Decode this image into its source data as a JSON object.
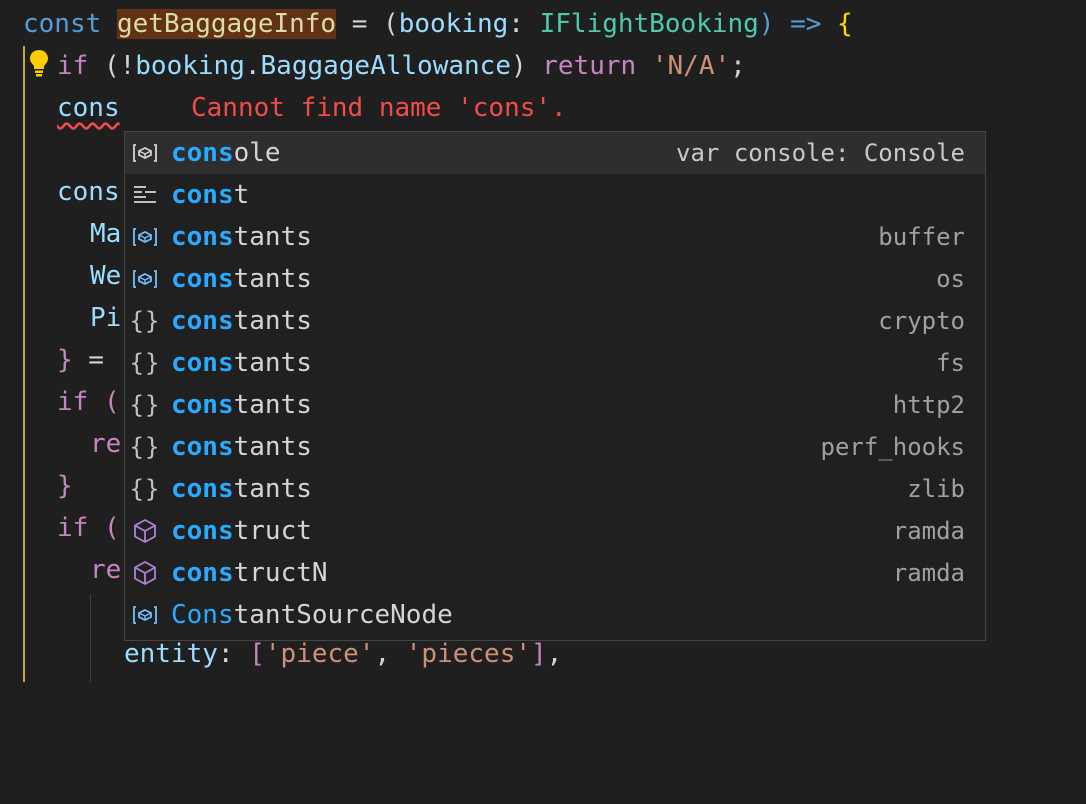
{
  "editor": {
    "line1": {
      "kw": "const",
      "fn": "getBaggageInfo",
      "eq": " = (",
      "param": "booking",
      "colon": ": ",
      "type": "IFlightBooking",
      "arrow": ") => ",
      "brace": "{"
    },
    "line2": {
      "if": "if",
      "open": " (!",
      "obj": "booking",
      "dot": ".",
      "prop": "BaggageAllowance",
      "close": ") ",
      "ret": "return",
      "sp": " ",
      "str": "'N/A'",
      "semi": ";"
    },
    "line3": {
      "typed": "cons",
      "error": "Cannot find name 'cons'."
    },
    "line5": {
      "text": "cons"
    },
    "line6": {
      "text": "Ma"
    },
    "line7": {
      "text": "We"
    },
    "line8": {
      "text": "Pi"
    },
    "line9": {
      "brace": "}",
      "rest": " ="
    },
    "line10": {
      "if": "if",
      "rest": " ("
    },
    "line11": {
      "text": "re"
    },
    "line12": {
      "brace": "}"
    },
    "line13": {
      "if": "if",
      "rest": " ("
    },
    "line14": {
      "text": "re"
    },
    "line16": {
      "key": "entity",
      "colon": ": ",
      "ob": "[",
      "s1": "'piece'",
      "comma": ", ",
      "s2": "'pieces'",
      "cb": "]",
      "tail": ","
    }
  },
  "suggestions": [
    {
      "match": "cons",
      "rest": "ole",
      "detail": "var console: Console",
      "icon": "variable-icon"
    },
    {
      "match": "cons",
      "rest": "t",
      "detail": "",
      "icon": "snippet-icon"
    },
    {
      "match": "cons",
      "rest": "tants",
      "detail": "buffer",
      "icon": "variable-icon"
    },
    {
      "match": "cons",
      "rest": "tants",
      "detail": "os",
      "icon": "variable-icon"
    },
    {
      "match": "cons",
      "rest": "tants",
      "detail": "crypto",
      "icon": "module-icon"
    },
    {
      "match": "cons",
      "rest": "tants",
      "detail": "fs",
      "icon": "module-icon"
    },
    {
      "match": "cons",
      "rest": "tants",
      "detail": "http2",
      "icon": "module-icon"
    },
    {
      "match": "cons",
      "rest": "tants",
      "detail": "perf_hooks",
      "icon": "module-icon"
    },
    {
      "match": "cons",
      "rest": "tants",
      "detail": "zlib",
      "icon": "module-icon"
    },
    {
      "match": "cons",
      "rest": "truct",
      "detail": "ramda",
      "icon": "method-cube-icon"
    },
    {
      "match": "cons",
      "rest": "tructN",
      "detail": "ramda",
      "icon": "method-cube-icon"
    },
    {
      "match": "Cons",
      "rest": "tantSourceNode",
      "detail": "",
      "icon": "variable-icon"
    }
  ],
  "icon_glyphs": {
    "module": "{}"
  },
  "colors": {
    "background": "#1f1f1f",
    "keyword": "#569cd6",
    "function": "#dcdcaa",
    "type": "#4ec9b0",
    "string": "#ce9178",
    "error": "#f14c4c",
    "match_highlight": "#2aaaff",
    "lightbulb": "#ffcc00",
    "method_icon": "#b180d7"
  }
}
